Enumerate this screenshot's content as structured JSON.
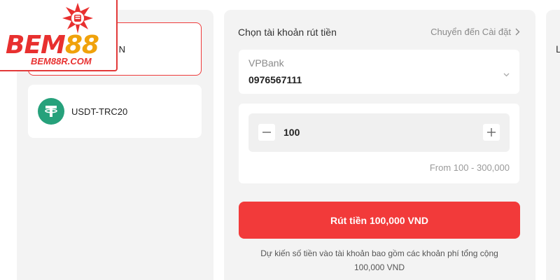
{
  "left_panel": {
    "methods": [
      {
        "label": "N",
        "selected": true
      },
      {
        "label": "USDT-TRC20",
        "selected": false,
        "icon": "tether-icon"
      }
    ]
  },
  "withdraw_form": {
    "title": "Chọn tài khoản rút tiền",
    "settings_link": "Chuyển đến Cài đặt",
    "bank": {
      "name": "VPBank",
      "account_number": "0976567111"
    },
    "amount": {
      "value": "100",
      "range_text": "From 100 - 300,000"
    },
    "submit_label": "Rút tiền 100,000 VND",
    "note_line1": "Dự kiến số tiền vào tài khoản bao gồm các khoản phí tổng cộng",
    "note_line2": "100,000 VND"
  },
  "right_panel": {
    "partial_text": "L"
  },
  "logo": {
    "main_red": "BEM",
    "main_gold": "88",
    "sub": "BEM88R.COM"
  },
  "colors": {
    "accent": "#f23a3a",
    "panel_bg": "#f3f3f3",
    "tether_green": "#26a17b",
    "logo_red": "#e8302f",
    "logo_gold": "#f0a20b"
  }
}
